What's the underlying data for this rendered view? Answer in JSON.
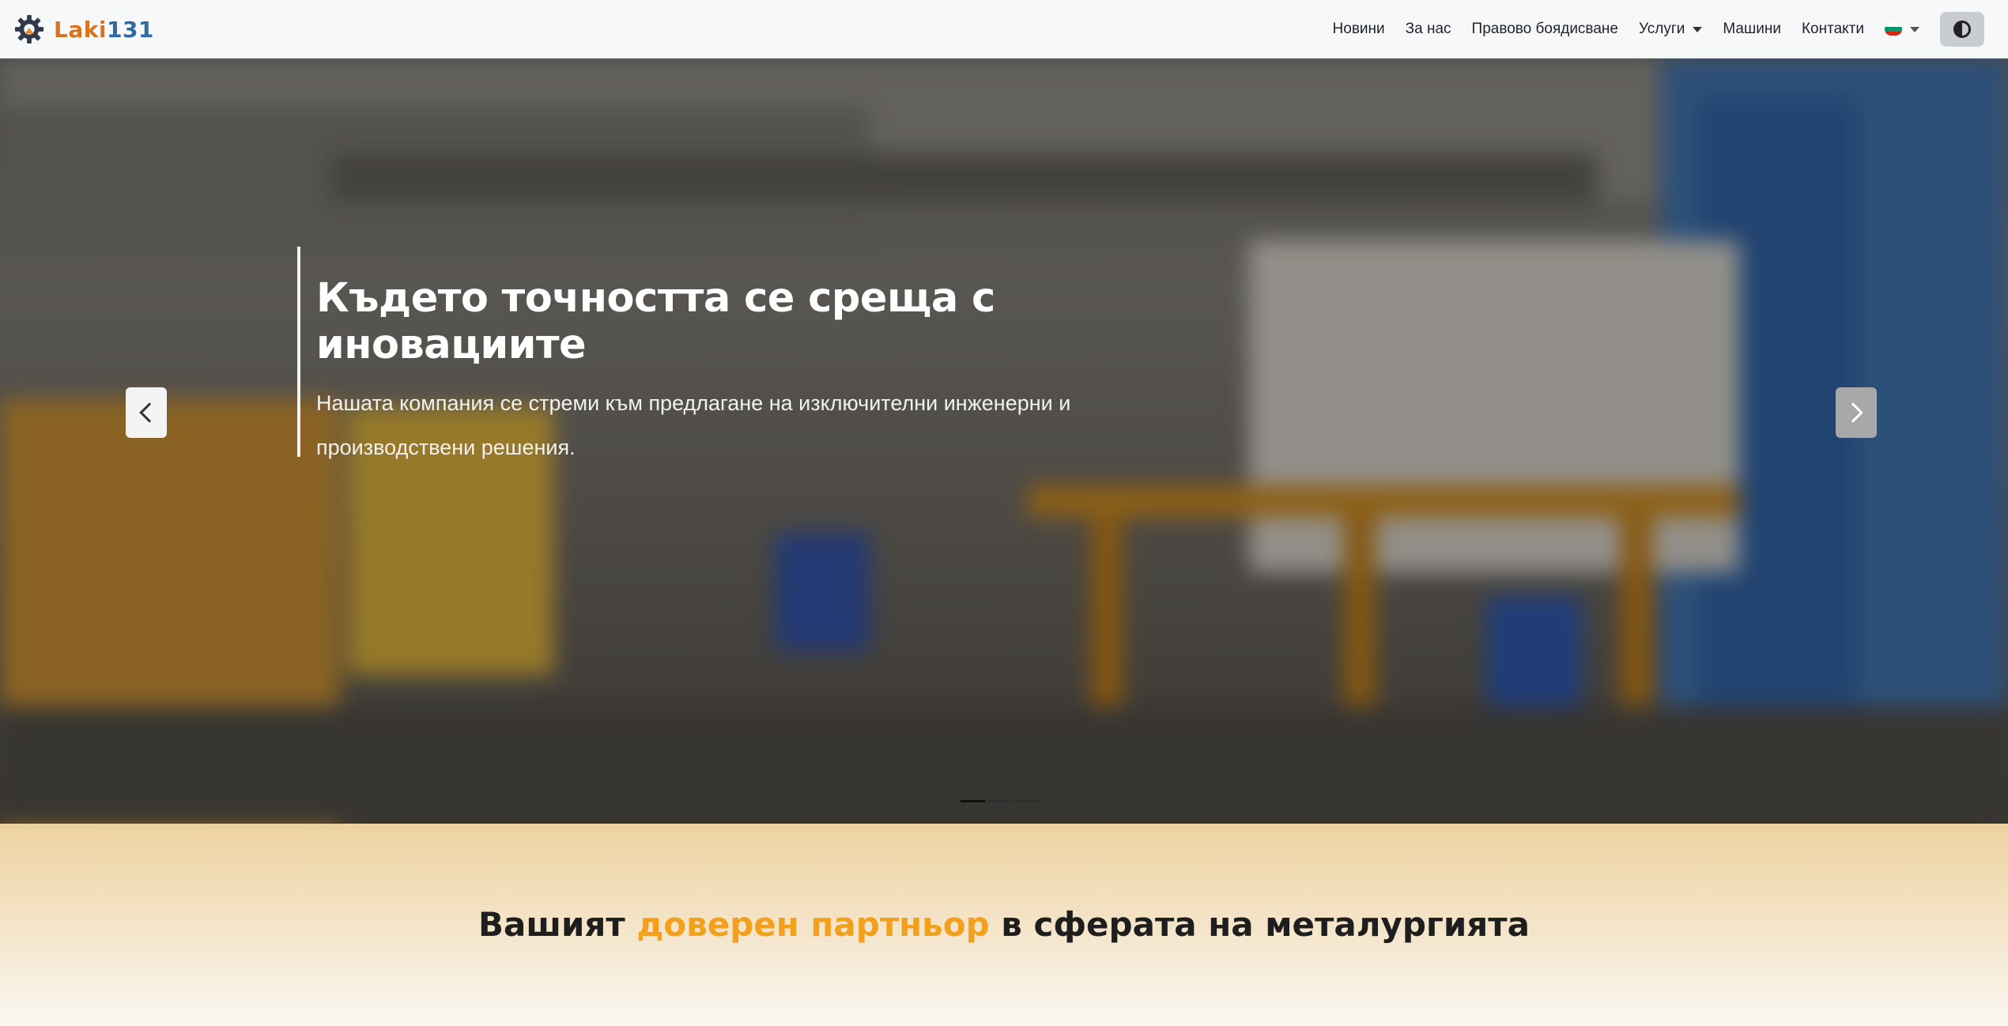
{
  "brand": {
    "part1": "Laki",
    "part2": "131",
    "color1": "#d9731f",
    "color2": "#2f6aa3",
    "icon": "gear-icon"
  },
  "nav": {
    "items": [
      "Новини",
      "За нас",
      "Правово боядисване"
    ],
    "services": "Услуги",
    "items_after": [
      "Машини",
      "Контакти"
    ],
    "language_icon": "bulgaria-flag-icon",
    "theme_icon": "contrast-icon"
  },
  "hero": {
    "title": "Където точността се среща с иновациите",
    "text": "Нашата компания се стреми към предлагане на изключителни инженерни и производствени решения.",
    "slide_count": 3,
    "active_slide": 1,
    "prev_icon": "chevron-left-icon",
    "next_icon": "chevron-right-icon"
  },
  "section": {
    "title_before": "Вашият ",
    "title_highlight": "доверен партньор",
    "title_after": " в сферата на металургията",
    "highlight_color": "#f3a01c"
  }
}
